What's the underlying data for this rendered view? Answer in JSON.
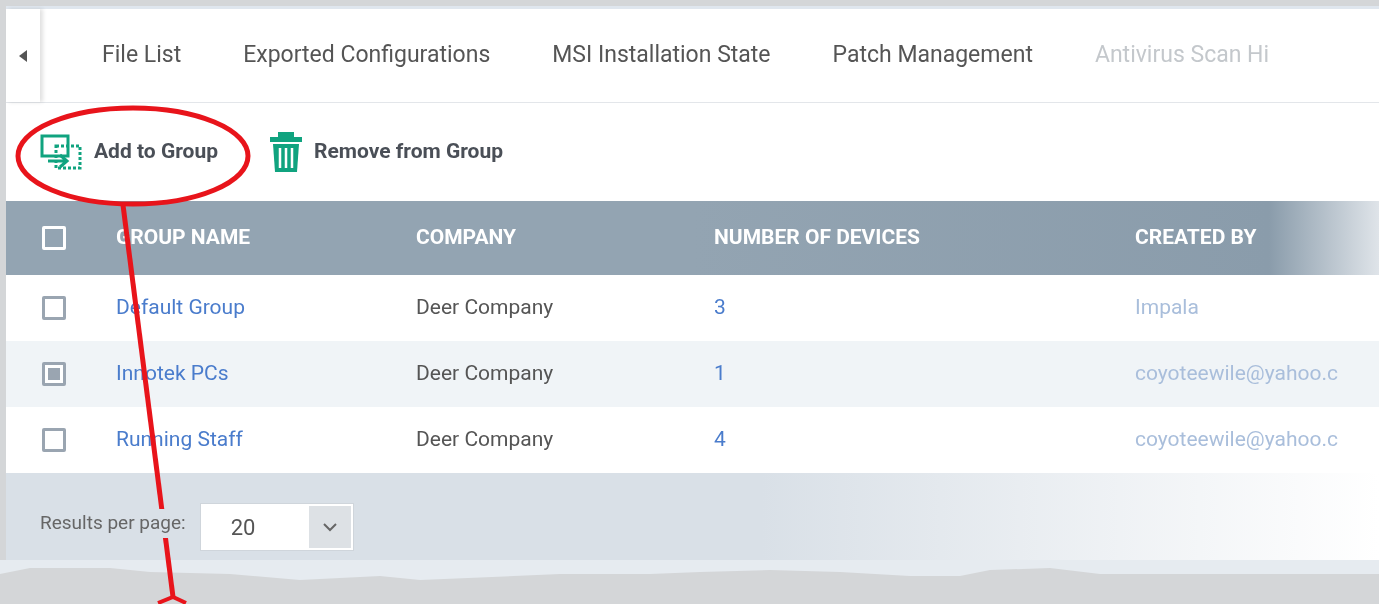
{
  "tabs": [
    {
      "label": "File List",
      "selected": false
    },
    {
      "label": "Exported Configurations",
      "selected": false
    },
    {
      "label": "MSI Installation State",
      "selected": false
    },
    {
      "label": "Patch Management",
      "selected": false
    },
    {
      "label": "Antivirus Scan Hi",
      "selected": false
    }
  ],
  "toolbar": [
    {
      "label": "Add to Group",
      "kind": "add"
    },
    {
      "label": "Remove from Group",
      "kind": "remove"
    }
  ],
  "table": {
    "header_checked": false,
    "columns": [
      "GROUP NAME",
      "COMPANY",
      "NUMBER OF DEVICES",
      "CREATED BY"
    ],
    "rows": [
      {
        "checked": false,
        "cells": [
          "Default Group",
          "Deer Company",
          "3",
          "Impala"
        ]
      },
      {
        "checked": true,
        "cells": [
          "Innotek PCs",
          "Deer Company",
          "1",
          "coyoteewile@yahoo.c"
        ]
      },
      {
        "checked": false,
        "cells": [
          "Running Staff",
          "Deer Company",
          "4",
          "coyoteewile@yahoo.c"
        ]
      }
    ]
  },
  "pagination": {
    "label": "Results per page:",
    "value": "20"
  }
}
